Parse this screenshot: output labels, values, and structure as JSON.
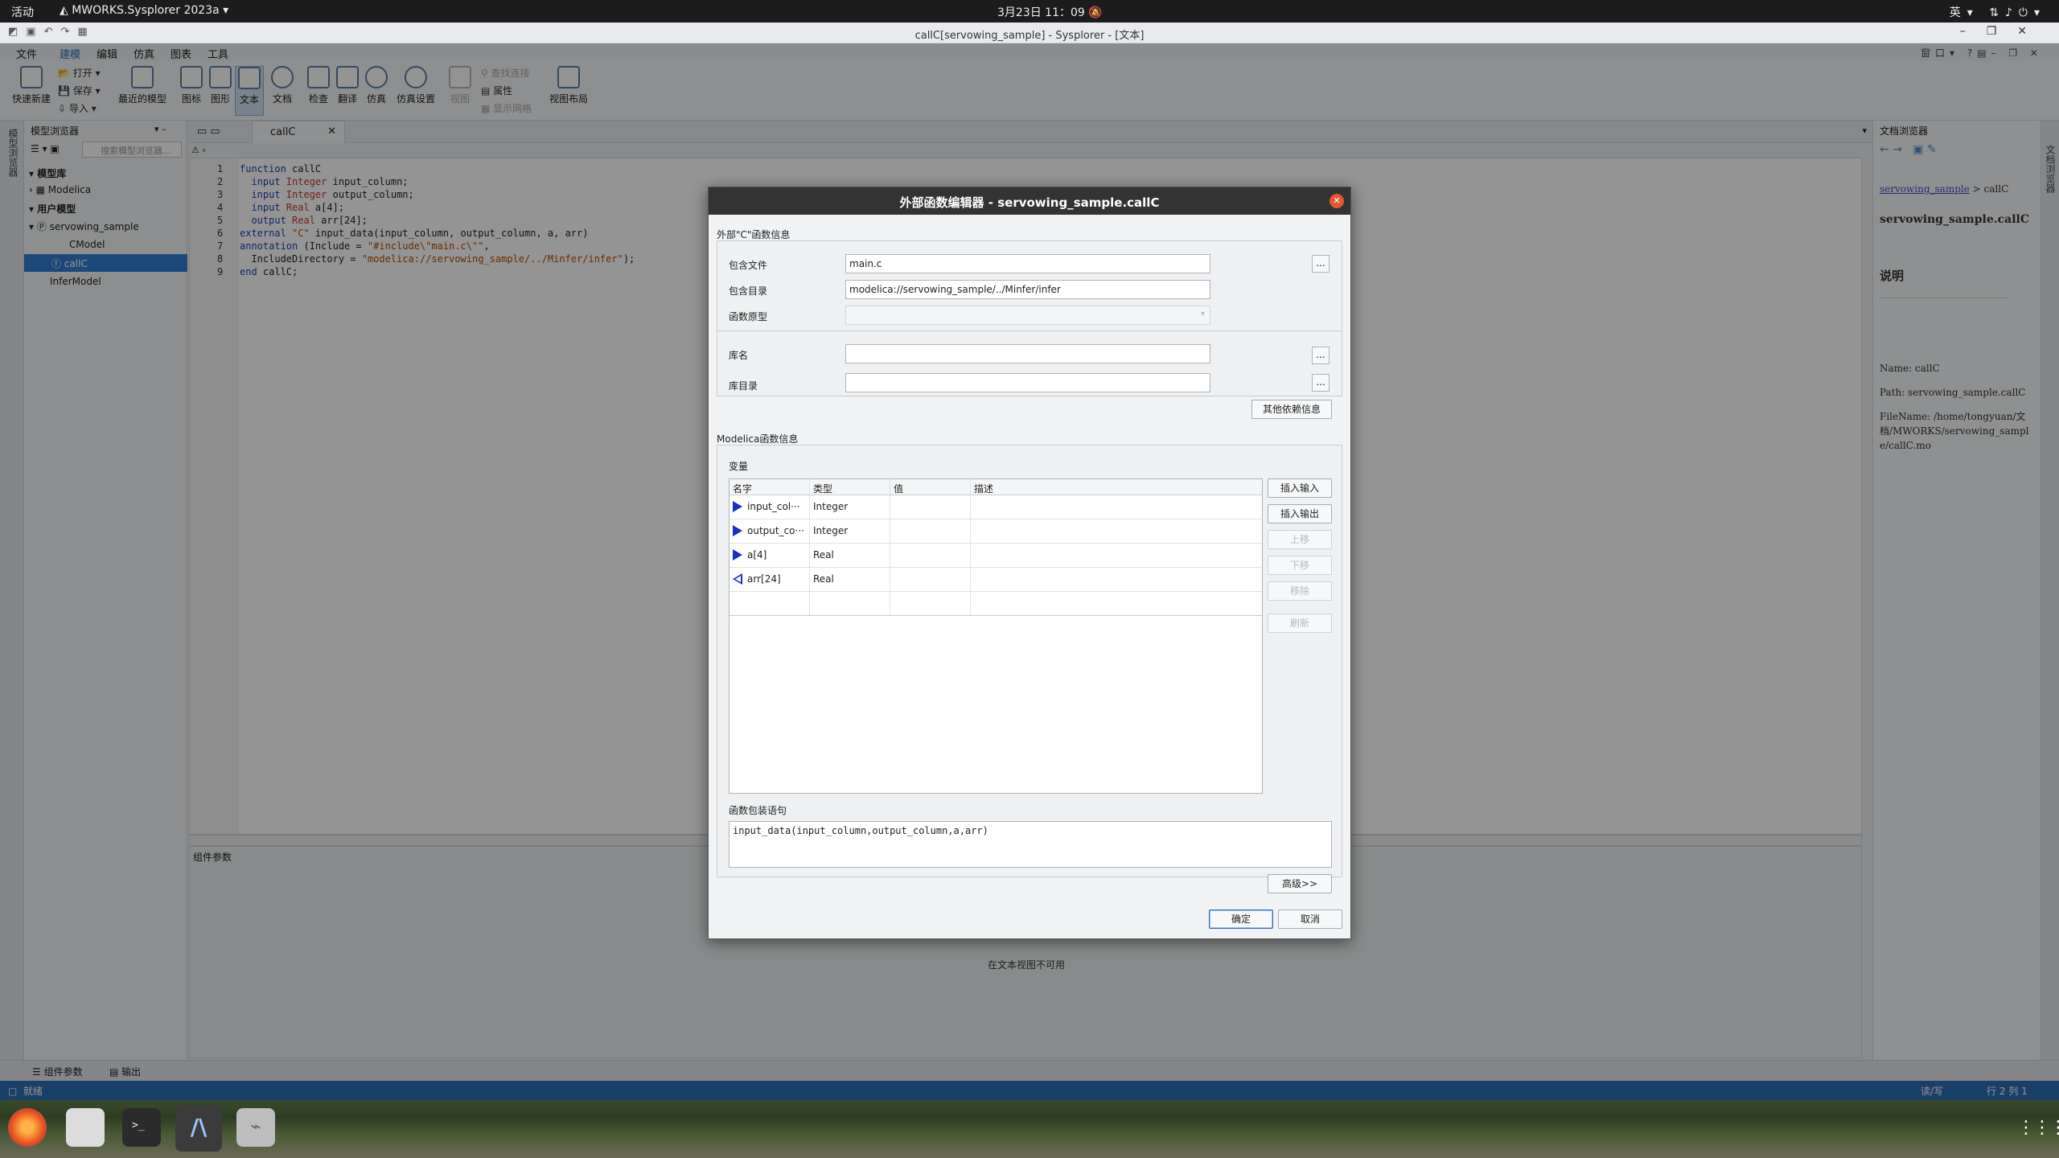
{
  "topbar": {
    "activities": "活动",
    "app_name": "MWORKS.Sysplorer 2023a",
    "clock": "3月23日  11：09",
    "ime": "英"
  },
  "window": {
    "title": "callC[servowing_sample] - Sysplorer - [文本]"
  },
  "menubar": {
    "items": [
      "文件",
      "建模",
      "编辑",
      "仿真",
      "图表",
      "工具"
    ],
    "active_index": 1,
    "right": "窗口"
  },
  "ribbon": {
    "quick_new": "快速新建",
    "open": "打开",
    "save": "保存",
    "import": "导入",
    "recent": "最近的模型",
    "icon": "图标",
    "diagram": "图形",
    "text": "文本",
    "doc": "文档",
    "check": "检查",
    "translate": "翻译",
    "simulate": "仿真",
    "sim_settings": "仿真设置",
    "view": "视图",
    "find_connect": "查找连接",
    "attributes": "属性",
    "show_grid": "显示网格",
    "view_layout": "视图布局"
  },
  "model_browser": {
    "title": "模型浏览器",
    "search_placeholder": "搜索模型浏览器...",
    "lib_header": "模型库",
    "modelica": "Modelica",
    "user_header": "用户模型",
    "package": "servowing_sample",
    "cmodel": "CModel",
    "callc": "callC",
    "infer": "InferModel",
    "side_label": "模型浏览器"
  },
  "editor": {
    "tab_label": "callC",
    "line_numbers": [
      "1",
      "2",
      "3",
      "4",
      "5",
      "6",
      "7",
      "8",
      "9"
    ],
    "code": {
      "l1_kw": "function",
      "l1_rest": " callC",
      "l2_in": "  input",
      "l2_ty": " Integer",
      "l2_rest": " input_column;",
      "l3_in": "  input",
      "l3_ty": " Integer",
      "l3_rest": " output_column;",
      "l4_in": "  input",
      "l4_ty": " Real",
      "l4_rest": " a[4];",
      "l5_in": "  output",
      "l5_ty": " Real",
      "l5_rest": " arr[24];",
      "l6_kw": "external",
      "l6_st": " \"C\"",
      "l6_rest": " input_data(input_column, output_column, a, arr)",
      "l7_kw": "annotation",
      "l7_rest": " (Include = ",
      "l7_st": "\"#include\\\"main.c\\\"\"",
      "l7_end": ",",
      "l8_rest": "  IncludeDirectory = ",
      "l8_st": "\"modelica://servowing_sample/../Minfer/infer\"",
      "l8_end": ");",
      "l9_kw": "end",
      "l9_rest": " callC;"
    },
    "comp_params_title": "组件参数",
    "not_available": "在文本视图不可用"
  },
  "doc_browser": {
    "title": "文档浏览器",
    "breadcrumb_link": "servowing_sample",
    "breadcrumb_tail": " > callC",
    "heading": "servowing_sample.callC",
    "desc_header": "说明",
    "name_line": "Name: callC",
    "path_line": "Path: servowing_sample.callC",
    "file_line": "FileName: /home/tongyuan/文档/MWORKS/servowing_sample/callC.mo",
    "side_label": "文档浏览器"
  },
  "bottom": {
    "tab_params": "组件参数",
    "tab_output": "输出",
    "status_ready": "就绪",
    "status_rw": "读/写",
    "status_pos": "行 2 列 1"
  },
  "dialog": {
    "title": "外部函数编辑器 - servowing_sample.callC",
    "c_section": "外部\"C\"函数信息",
    "include_file_label": "包含文件",
    "include_file_value": "main.c",
    "include_dir_label": "包含目录",
    "include_dir_value": "modelica://servowing_sample/../Minfer/infer",
    "prototype_label": "函数原型",
    "lib_name_label": "库名",
    "lib_dir_label": "库目录",
    "other_deps": "其他依赖信息",
    "browse": "...",
    "modelica_section": "Modelica函数信息",
    "vars_label": "变量",
    "columns": [
      "名字",
      "类型",
      "值",
      "描述"
    ],
    "rows": [
      {
        "name": "input_col···",
        "type": "Integer",
        "value": "",
        "desc": "",
        "dir": "in"
      },
      {
        "name": "output_co···",
        "type": "Integer",
        "value": "",
        "desc": "",
        "dir": "in"
      },
      {
        "name": "a[4]",
        "type": "Real",
        "value": "",
        "desc": "",
        "dir": "in"
      },
      {
        "name": "arr[24]",
        "type": "Real",
        "value": "",
        "desc": "",
        "dir": "out"
      }
    ],
    "btn_insert_input": "插入输入",
    "btn_insert_output": "插入输出",
    "btn_up": "上移",
    "btn_down": "下移",
    "btn_remove": "移除",
    "btn_refresh": "刷新",
    "call_label": "函数包装语句",
    "call_value": "input_data(input_column,output_column,a,arr)",
    "btn_advanced": "高级>>",
    "btn_ok": "确定",
    "btn_cancel": "取消"
  }
}
